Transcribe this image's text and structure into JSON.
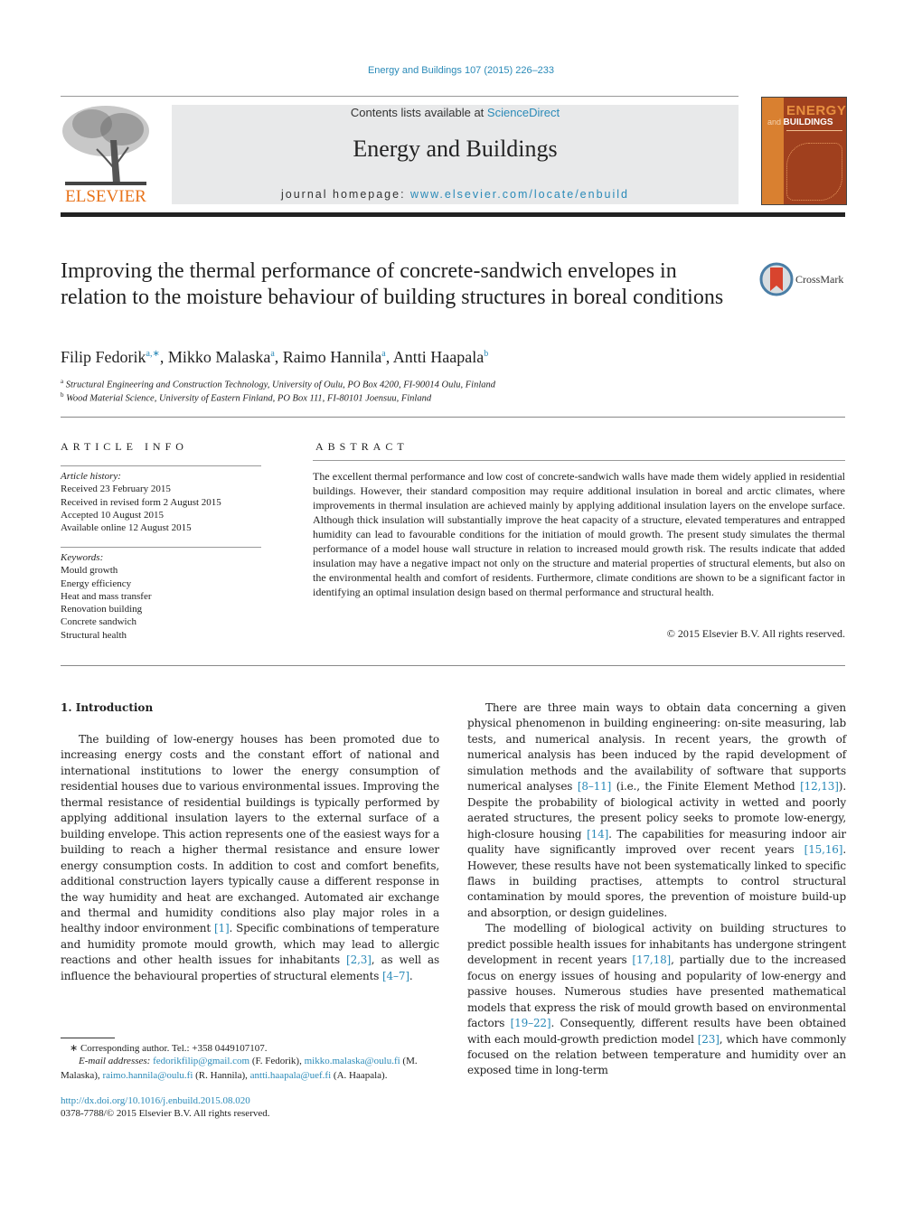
{
  "header": {
    "citation": "Energy and Buildings 107 (2015) 226–233",
    "contents_prefix": "Contents lists available at ",
    "contents_link": "ScienceDirect",
    "journal_name": "Energy and Buildings",
    "homepage_prefix": "journal homepage: ",
    "homepage_link": "www.elsevier.com/locate/enbuild",
    "publisher_logo_text": "ELSEVIER",
    "cover": {
      "title1": "ENERGY",
      "title2_small": "and",
      "title2_big": "BUILDINGS"
    },
    "crossmark_label": "CrossMark",
    "colors": {
      "link": "#2a8ab8",
      "elsevier_orange": "#e8731a",
      "cover_brown": "#a0401e"
    }
  },
  "article": {
    "title": "Improving the thermal performance of concrete-sandwich envelopes in relation to the moisture behaviour of building structures in boreal conditions",
    "authors": [
      {
        "name": "Filip Fedorik",
        "marks": "a,∗"
      },
      {
        "name": "Mikko Malaska",
        "marks": "a"
      },
      {
        "name": "Raimo Hannila",
        "marks": "a"
      },
      {
        "name": "Antti Haapala",
        "marks": "b"
      }
    ],
    "affiliations": [
      {
        "mark": "a",
        "text": "Structural Engineering and Construction Technology, University of Oulu, PO Box 4200, FI-90014 Oulu, Finland"
      },
      {
        "mark": "b",
        "text": "Wood Material Science, University of Eastern Finland, PO Box 111, FI-80101 Joensuu, Finland"
      }
    ]
  },
  "article_info": {
    "heading": "ARTICLE INFO",
    "history_label": "Article history:",
    "history": [
      "Received 23 February 2015",
      "Received in revised form 2 August 2015",
      "Accepted 10 August 2015",
      "Available online 12 August 2015"
    ],
    "keywords_label": "Keywords:",
    "keywords": [
      "Mould growth",
      "Energy efficiency",
      "Heat and mass transfer",
      "Renovation building",
      "Concrete sandwich",
      "Structural health"
    ]
  },
  "abstract": {
    "heading": "ABSTRACT",
    "text": "The excellent thermal performance and low cost of concrete-sandwich walls have made them widely applied in residential buildings. However, their standard composition may require additional insulation in boreal and arctic climates, where improvements in thermal insulation are achieved mainly by applying additional insulation layers on the envelope surface. Although thick insulation will substantially improve the heat capacity of a structure, elevated temperatures and entrapped humidity can lead to favourable conditions for the initiation of mould growth. The present study simulates the thermal performance of a model house wall structure in relation to increased mould growth risk. The results indicate that added insulation may have a negative impact not only on the structure and material properties of structural elements, but also on the environmental health and comfort of residents. Furthermore, climate conditions are shown to be a significant factor in identifying an optimal insulation design based on thermal performance and structural health.",
    "copyright": "© 2015 Elsevier B.V. All rights reserved."
  },
  "body": {
    "section_heading": "1.  Introduction",
    "left_para": [
      {
        "t": "The building of low-energy houses has been promoted due to increasing energy costs and the constant effort of national and international institutions to lower the energy consumption of residential houses due to various environmental issues. Improving the thermal resistance of residential buildings is typically performed by applying additional insulation layers to the external surface of a building envelope. This action represents one of the easiest ways for a building to reach a higher thermal resistance and ensure lower energy consumption costs. In addition to cost and comfort benefits, additional construction layers typically cause a different response in the way humidity and heat are exchanged. Automated air exchange and thermal and humidity conditions also play major roles in a healthy indoor environment "
      },
      {
        "ref": "[1]"
      },
      {
        "t": ". Specific combinations of temperature and humidity promote mould growth, which may lead to allergic reactions and other health issues for inhabitants "
      },
      {
        "ref": "[2,3]"
      },
      {
        "t": ", as well as influence the behavioural properties of structural elements "
      },
      {
        "ref": "[4–7]"
      },
      {
        "t": "."
      }
    ],
    "right_para1": [
      {
        "t": "There are three main ways to obtain data concerning a given physical phenomenon in building engineering: on-site measuring, lab tests, and numerical analysis. In recent years, the growth of numerical analysis has been induced by the rapid development of simulation methods and the availability of software that supports numerical analyses "
      },
      {
        "ref": "[8–11]"
      },
      {
        "t": " (i.e., the Finite Element Method "
      },
      {
        "ref": "[12,13]"
      },
      {
        "t": "). Despite the probability of biological activity in wetted and poorly aerated structures, the present policy seeks to promote low-energy, high-closure housing "
      },
      {
        "ref": "[14]"
      },
      {
        "t": ". The capabilities for measuring indoor air quality have significantly improved over recent years "
      },
      {
        "ref": "[15,16]"
      },
      {
        "t": ". However, these results have not been systematically linked to specific flaws in building practises, attempts to control structural contamination by mould spores, the prevention of moisture build-up and absorption, or design guidelines."
      }
    ],
    "right_para2": [
      {
        "t": "The modelling of biological activity on building structures to predict possible health issues for inhabitants has undergone stringent development in recent years "
      },
      {
        "ref": "[17,18]"
      },
      {
        "t": ", partially due to the increased focus on energy issues of housing and popularity of low-energy and passive houses. Numerous studies have presented mathematical models that express the risk of mould growth based on environmental factors "
      },
      {
        "ref": "[19–22]"
      },
      {
        "t": ". Consequently, different results have been obtained with each mould-growth prediction model "
      },
      {
        "ref": "[23]"
      },
      {
        "t": ", which have commonly focused on the relation between temperature and humidity over an exposed time in long-term"
      }
    ]
  },
  "footnotes": {
    "corresponding": "∗  Corresponding author. Tel.: +358 0449107107.",
    "email_label": "E-mail addresses: ",
    "emails": [
      {
        "addr": "fedorikfilip@gmail.com",
        "who": " (F. Fedorik), "
      },
      {
        "addr": "mikko.malaska@oulu.fi",
        "who": " (M. Malaska), "
      },
      {
        "addr": "raimo.hannila@oulu.fi",
        "who": " (R. Hannila), "
      },
      {
        "addr": "antti.haapala@uef.fi",
        "who": " (A. Haapala)."
      }
    ],
    "doi": "http://dx.doi.org/10.1016/j.enbuild.2015.08.020",
    "issn": "0378-7788/© 2015 Elsevier B.V. All rights reserved."
  }
}
